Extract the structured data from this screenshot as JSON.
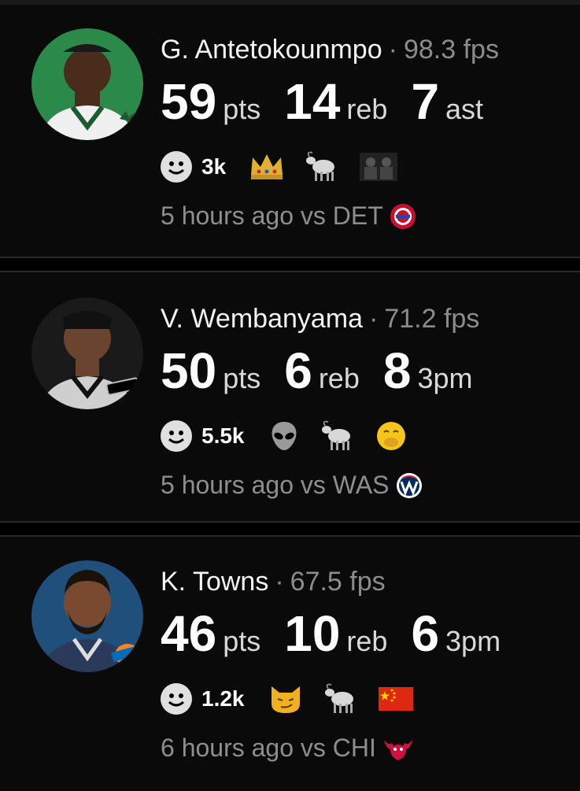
{
  "players": [
    {
      "name": "G. Antetokounmpo",
      "fps": "98.3 fps",
      "stats": [
        {
          "value": "59",
          "unit": "pts"
        },
        {
          "value": "14",
          "unit": "reb"
        },
        {
          "value": "7",
          "unit": "ast"
        }
      ],
      "reaction_count": "3k",
      "reactions": [
        "crown-icon",
        "goat-icon",
        "goat-memes-icon"
      ],
      "time": "5 hours ago vs DET",
      "opponent_logo": "pistons-logo-icon"
    },
    {
      "name": "V. Wembanyama",
      "fps": "71.2 fps",
      "stats": [
        {
          "value": "50",
          "unit": "pts"
        },
        {
          "value": "6",
          "unit": "reb"
        },
        {
          "value": "8",
          "unit": "3pm"
        }
      ],
      "reaction_count": "5.5k",
      "reactions": [
        "alien-icon",
        "goat-icon",
        "face-hand-over-mouth-icon"
      ],
      "time": "5 hours ago vs WAS",
      "opponent_logo": "wizards-logo-icon"
    },
    {
      "name": "K. Towns",
      "fps": "67.5 fps",
      "stats": [
        {
          "value": "46",
          "unit": "pts"
        },
        {
          "value": "10",
          "unit": "reb"
        },
        {
          "value": "6",
          "unit": "3pm"
        }
      ],
      "reaction_count": "1.2k",
      "reactions": [
        "smirk-cat-icon",
        "goat-icon",
        "china-flag-icon"
      ],
      "time": "6 hours ago vs CHI",
      "opponent_logo": "bulls-logo-icon"
    }
  ],
  "separator": "·"
}
